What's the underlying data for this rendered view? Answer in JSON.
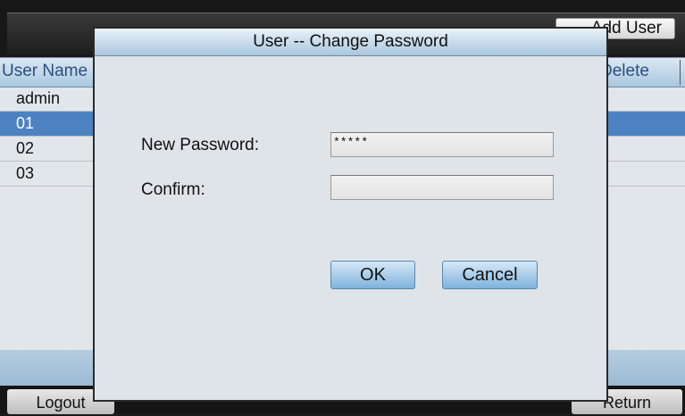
{
  "header": {
    "add_user_label": "Add User"
  },
  "table": {
    "col_user_name": "User Name",
    "col_delete": "Delete",
    "rows": [
      {
        "name": "admin"
      },
      {
        "name": "01"
      },
      {
        "name": "02"
      },
      {
        "name": "03"
      }
    ],
    "selected_row": 1
  },
  "footer": {
    "logout_label": "Logout",
    "return_label": "Return"
  },
  "dialog": {
    "title": "User -- Change Password",
    "new_password_label": "New Password:",
    "new_password_value": "*****",
    "confirm_label": "Confirm:",
    "confirm_value": "",
    "ok_label": "OK",
    "cancel_label": "Cancel"
  }
}
